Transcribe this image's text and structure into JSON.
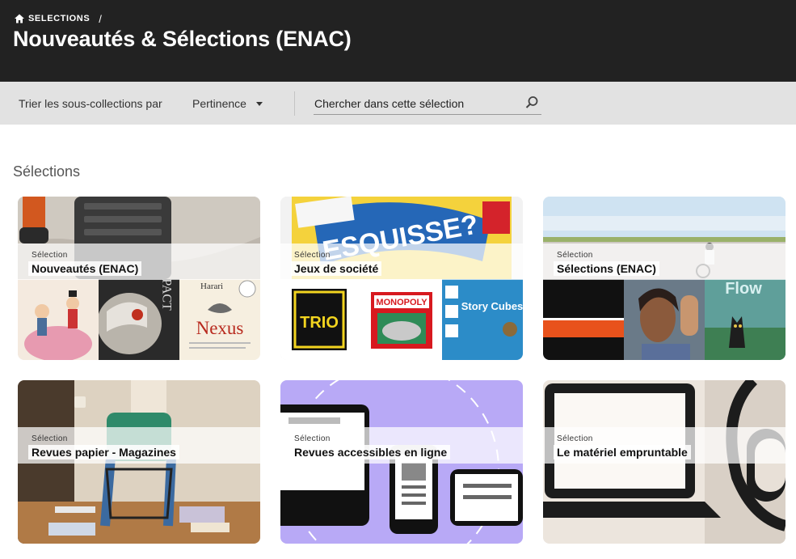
{
  "header": {
    "breadcrumb": {
      "home_icon": "home-icon",
      "label": "SELECTIONS",
      "separator": "/"
    },
    "title": "Nouveautés & Sélections (ENAC)"
  },
  "toolbar": {
    "sort_label": "Trier les sous-collections par",
    "sort_value": "Pertinence",
    "search_placeholder": "Chercher dans cette sélection",
    "search_icon": "search-icon"
  },
  "section": {
    "title": "Sélections"
  },
  "cards": [
    {
      "tag": "Sélection",
      "title": "Nouveautés (ENAC)",
      "thumb_texts": [
        "",
        "MPACT",
        "Harari",
        "Nexus"
      ]
    },
    {
      "tag": "Sélection",
      "title": "Jeux de société",
      "hero_text": "ESQUISSE?",
      "thumb_texts": [
        "TRIO",
        "MONOPOLY",
        "Story Cubes"
      ]
    },
    {
      "tag": "Sélection",
      "title": "Sélections (ENAC)",
      "thumb_texts": [
        "",
        "",
        "Flow"
      ]
    },
    {
      "tag": "Sélection",
      "title": "Revues papier - Magazines"
    },
    {
      "tag": "Sélection",
      "title": "Revues accessibles en ligne"
    },
    {
      "tag": "Sélection",
      "title": "Le matériel empruntable"
    }
  ]
}
